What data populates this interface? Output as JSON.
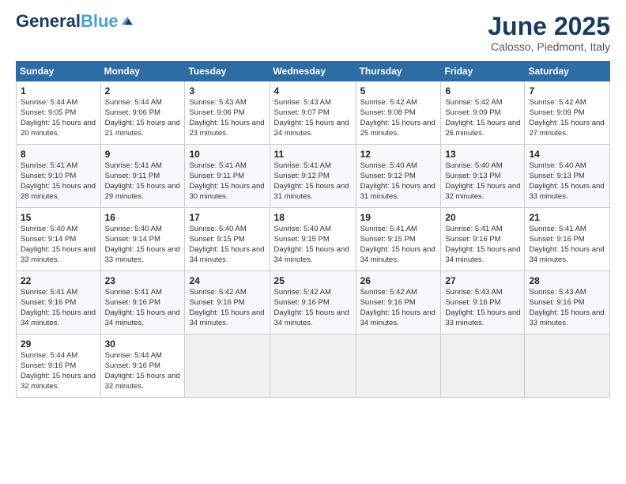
{
  "header": {
    "logo_main": "General",
    "logo_accent": "Blue",
    "month_title": "June 2025",
    "subtitle": "Calosso, Piedmont, Italy"
  },
  "weekdays": [
    "Sunday",
    "Monday",
    "Tuesday",
    "Wednesday",
    "Thursday",
    "Friday",
    "Saturday"
  ],
  "days": [
    {
      "date": null
    },
    {
      "date": null
    },
    {
      "date": null
    },
    {
      "date": null
    },
    {
      "date": null
    },
    {
      "date": null
    },
    {
      "date": "7",
      "sunrise": "5:42 AM",
      "sunset": "9:09 PM",
      "daylight": "15 hours and 27 minutes."
    },
    {
      "date": "8",
      "sunrise": "5:41 AM",
      "sunset": "9:10 PM",
      "daylight": "15 hours and 28 minutes."
    },
    {
      "date": "9",
      "sunrise": "5:41 AM",
      "sunset": "9:11 PM",
      "daylight": "15 hours and 29 minutes."
    },
    {
      "date": "10",
      "sunrise": "5:41 AM",
      "sunset": "9:11 PM",
      "daylight": "15 hours and 30 minutes."
    },
    {
      "date": "11",
      "sunrise": "5:41 AM",
      "sunset": "9:12 PM",
      "daylight": "15 hours and 31 minutes."
    },
    {
      "date": "12",
      "sunrise": "5:40 AM",
      "sunset": "9:12 PM",
      "daylight": "15 hours and 31 minutes."
    },
    {
      "date": "13",
      "sunrise": "5:40 AM",
      "sunset": "9:13 PM",
      "daylight": "15 hours and 32 minutes."
    },
    {
      "date": "14",
      "sunrise": "5:40 AM",
      "sunset": "9:13 PM",
      "daylight": "15 hours and 33 minutes."
    },
    {
      "date": "15",
      "sunrise": "5:40 AM",
      "sunset": "9:14 PM",
      "daylight": "15 hours and 33 minutes."
    },
    {
      "date": "16",
      "sunrise": "5:40 AM",
      "sunset": "9:14 PM",
      "daylight": "15 hours and 33 minutes."
    },
    {
      "date": "17",
      "sunrise": "5:40 AM",
      "sunset": "9:15 PM",
      "daylight": "15 hours and 34 minutes."
    },
    {
      "date": "18",
      "sunrise": "5:40 AM",
      "sunset": "9:15 PM",
      "daylight": "15 hours and 34 minutes."
    },
    {
      "date": "19",
      "sunrise": "5:41 AM",
      "sunset": "9:15 PM",
      "daylight": "15 hours and 34 minutes."
    },
    {
      "date": "20",
      "sunrise": "5:41 AM",
      "sunset": "9:16 PM",
      "daylight": "15 hours and 34 minutes."
    },
    {
      "date": "21",
      "sunrise": "5:41 AM",
      "sunset": "9:16 PM",
      "daylight": "15 hours and 34 minutes."
    },
    {
      "date": "22",
      "sunrise": "5:41 AM",
      "sunset": "9:16 PM",
      "daylight": "15 hours and 34 minutes."
    },
    {
      "date": "23",
      "sunrise": "5:41 AM",
      "sunset": "9:16 PM",
      "daylight": "15 hours and 34 minutes."
    },
    {
      "date": "24",
      "sunrise": "5:42 AM",
      "sunset": "9:16 PM",
      "daylight": "15 hours and 34 minutes."
    },
    {
      "date": "25",
      "sunrise": "5:42 AM",
      "sunset": "9:16 PM",
      "daylight": "15 hours and 34 minutes."
    },
    {
      "date": "26",
      "sunrise": "5:42 AM",
      "sunset": "9:16 PM",
      "daylight": "15 hours and 34 minutes."
    },
    {
      "date": "27",
      "sunrise": "5:43 AM",
      "sunset": "9:16 PM",
      "daylight": "15 hours and 33 minutes."
    },
    {
      "date": "28",
      "sunrise": "5:43 AM",
      "sunset": "9:16 PM",
      "daylight": "15 hours and 33 minutes."
    },
    {
      "date": "29",
      "sunrise": "5:44 AM",
      "sunset": "9:16 PM",
      "daylight": "15 hours and 32 minutes."
    },
    {
      "date": "30",
      "sunrise": "5:44 AM",
      "sunset": "9:16 PM",
      "daylight": "15 hours and 32 minutes."
    }
  ],
  "week1": [
    {
      "date": "1",
      "sunrise": "5:44 AM",
      "sunset": "9:05 PM",
      "daylight": "15 hours and 20 minutes."
    },
    {
      "date": "2",
      "sunrise": "5:44 AM",
      "sunset": "9:06 PM",
      "daylight": "15 hours and 21 minutes."
    },
    {
      "date": "3",
      "sunrise": "5:43 AM",
      "sunset": "9:06 PM",
      "daylight": "15 hours and 23 minutes."
    },
    {
      "date": "4",
      "sunrise": "5:43 AM",
      "sunset": "9:07 PM",
      "daylight": "15 hours and 24 minutes."
    },
    {
      "date": "5",
      "sunrise": "5:42 AM",
      "sunset": "9:08 PM",
      "daylight": "15 hours and 25 minutes."
    },
    {
      "date": "6",
      "sunrise": "5:42 AM",
      "sunset": "9:09 PM",
      "daylight": "15 hours and 26 minutes."
    },
    {
      "date": "7",
      "sunrise": "5:42 AM",
      "sunset": "9:09 PM",
      "daylight": "15 hours and 27 minutes."
    }
  ]
}
